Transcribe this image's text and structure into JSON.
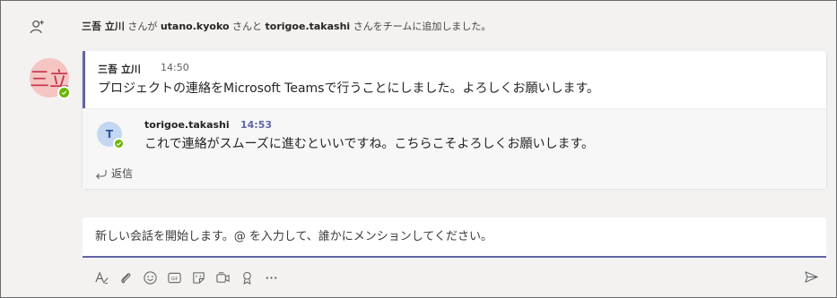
{
  "system_message": {
    "actor": "三吾 立川",
    "text_part1": " さんが ",
    "user1": "utano.kyoko",
    "text_part2": " さんと ",
    "user2": "torigoe.takashi",
    "text_part3": " さんをチームに追加しました。",
    "icon": "add-person-icon"
  },
  "thread": {
    "root": {
      "avatar_text": "三立",
      "author": "三吾 立川",
      "time": "14:50",
      "body": "プロジェクトの連絡をMicrosoft Teamsで行うことにしました。よろしくお願いします。"
    },
    "reply": {
      "avatar_text": "T",
      "author": "torigoe.takashi",
      "time": "14:53",
      "body": "これで連絡がスムーズに進むといいですね。こちらこそよろしくお願いします。"
    },
    "reply_label": "返信"
  },
  "compose": {
    "placeholder": "新しい会話を開始します。@ を入力して、誰かにメンションしてください。"
  },
  "toolbar": {
    "icons": [
      "format-icon",
      "attach-icon",
      "emoji-icon",
      "gif-icon",
      "sticker-icon",
      "meet-now-icon",
      "praise-icon",
      "more-options-icon",
      "send-icon"
    ]
  },
  "colors": {
    "accent": "#6264a7",
    "presence": "#6bb700",
    "avatar_bg": "#f4c5c3",
    "avatar_fg": "#c4314b",
    "reply_avatar_bg": "#c3d7f2"
  }
}
